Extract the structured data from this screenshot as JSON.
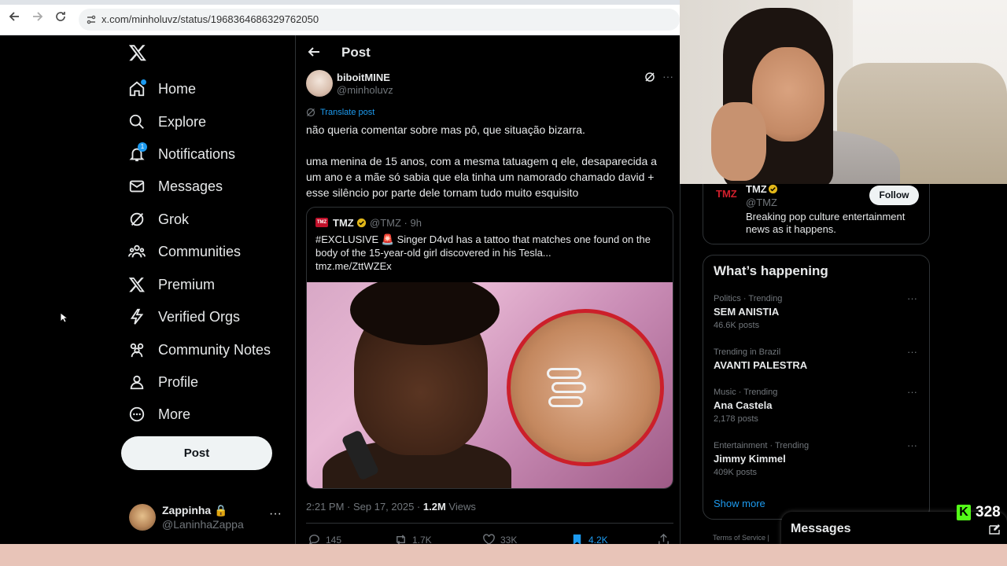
{
  "browser": {
    "url": "x.com/minholuvz/status/1968364686329762050"
  },
  "nav": {
    "items": [
      {
        "label": "Home",
        "icon": "home-icon"
      },
      {
        "label": "Explore",
        "icon": "search-icon"
      },
      {
        "label": "Notifications",
        "icon": "bell-icon",
        "badge": "1"
      },
      {
        "label": "Messages",
        "icon": "envelope-icon"
      },
      {
        "label": "Grok",
        "icon": "grok-icon"
      },
      {
        "label": "Communities",
        "icon": "communities-icon"
      },
      {
        "label": "Premium",
        "icon": "x-logo-icon"
      },
      {
        "label": "Verified Orgs",
        "icon": "lightning-icon"
      },
      {
        "label": "Community Notes",
        "icon": "community-notes-icon"
      },
      {
        "label": "Profile",
        "icon": "person-icon"
      },
      {
        "label": "More",
        "icon": "more-circle-icon"
      }
    ],
    "post_button": "Post"
  },
  "account": {
    "name": "Zappinha 🔒",
    "handle": "@LaninhaZappa",
    "more": "···"
  },
  "header": {
    "title": "Post"
  },
  "post": {
    "author_name": "biboitMINE",
    "author_handle": "@minholuvz",
    "translate": "Translate post",
    "text_line1": "não queria comentar sobre mas pô, que situação bizarra.",
    "text_line2": "uma menina de 15 anos, com a mesma tatuagem q ele, desaparecida a um ano e a mãe só sabia que ela tinha um namorado chamado david + esse silêncio por parte dele tornam tudo muito esquisito",
    "timestamp": "2:21 PM · Sep 17, 2025 · ",
    "views_count": "1.2M",
    "views_label": " Views",
    "replies": "145",
    "reposts": "1.7K",
    "likes": "33K",
    "bookmarks": "4.2K"
  },
  "quote": {
    "logo": "TMZ",
    "name": "TMZ",
    "meta": "@TMZ · 9h",
    "text": "#EXCLUSIVE 🚨 Singer D4vd has a tattoo that matches one found on the body of the 15-year-old girl discovered in his Tesla...",
    "link": "tmz.me/ZttWZEx"
  },
  "who_to_follow": {
    "logo": "TMZ",
    "name": "TMZ",
    "handle": "@TMZ",
    "follow": "Follow",
    "bio": "Breaking pop culture entertainment news as it happens."
  },
  "trends": {
    "title": "What’s happening",
    "items": [
      {
        "category": "Politics · Trending",
        "name": "SEM ANISTIA",
        "count": "46.6K posts"
      },
      {
        "category": "Trending in Brazil",
        "name": "AVANTI PALESTRA",
        "count": ""
      },
      {
        "category": "Music · Trending",
        "name": "Ana Castela",
        "count": "2,178 posts"
      },
      {
        "category": "Entertainment · Trending",
        "name": "Jimmy Kimmel",
        "count": "409K posts"
      }
    ],
    "show_more": "Show more",
    "more": "···"
  },
  "footer": {
    "terms": "Terms of Service  |"
  },
  "messages_drawer": {
    "title": "Messages"
  },
  "kick": {
    "logo": "K",
    "viewers": "328"
  },
  "colors": {
    "accent": "#1d9bf0",
    "background": "#000000",
    "kick_green": "#53fc18"
  }
}
